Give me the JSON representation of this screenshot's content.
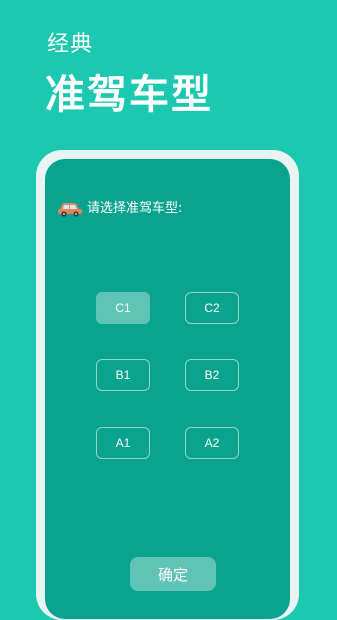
{
  "hero": {
    "subtitle": "经典",
    "title": "准驾车型"
  },
  "screen": {
    "prompt": "请选择准驾车型:",
    "prompt_icon": "car-icon",
    "options": [
      {
        "label": "C1",
        "selected": true
      },
      {
        "label": "C2",
        "selected": false
      },
      {
        "label": "B1",
        "selected": false
      },
      {
        "label": "B2",
        "selected": false
      },
      {
        "label": "A1",
        "selected": false
      },
      {
        "label": "A2",
        "selected": false
      }
    ],
    "confirm_label": "确定"
  },
  "colors": {
    "background": "#1cc9b0",
    "screen": "#0aa38e",
    "frame": "#e8f4f2",
    "text": "#ffffff"
  }
}
